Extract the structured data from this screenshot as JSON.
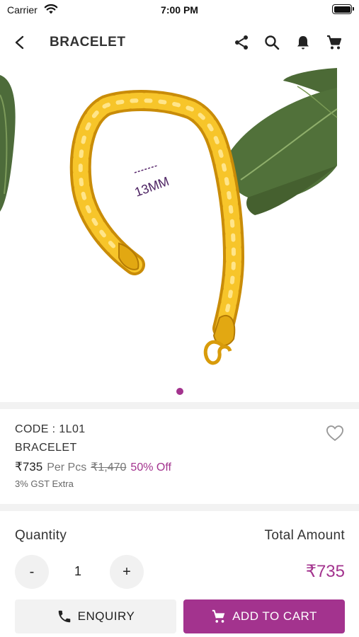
{
  "status_bar": {
    "carrier": "Carrier",
    "time": "7:00 PM"
  },
  "header": {
    "title": "BRACELET",
    "icons": [
      "back-icon",
      "share-icon",
      "search-icon",
      "bell-icon",
      "cart-icon"
    ]
  },
  "gallery": {
    "image_label": "13MM",
    "image_count": 1,
    "active_index": 0
  },
  "product": {
    "code": "CODE : 1L01",
    "name": "BRACELET",
    "price": "₹735",
    "unit": "Per Pcs",
    "mrp": "₹1,470",
    "discount": "50% Off",
    "tax_note": "3% GST Extra"
  },
  "quantity": {
    "label": "Quantity",
    "minus": "-",
    "plus": "+",
    "value": "1",
    "total_label": "Total Amount",
    "total_value": "₹735"
  },
  "actions": {
    "enquiry": "ENQUIRY",
    "add_to_cart": "ADD TO CART"
  },
  "colors": {
    "accent": "#a3338e",
    "divider": "#f2f2f2",
    "button_bg": "#f2f2f2"
  }
}
